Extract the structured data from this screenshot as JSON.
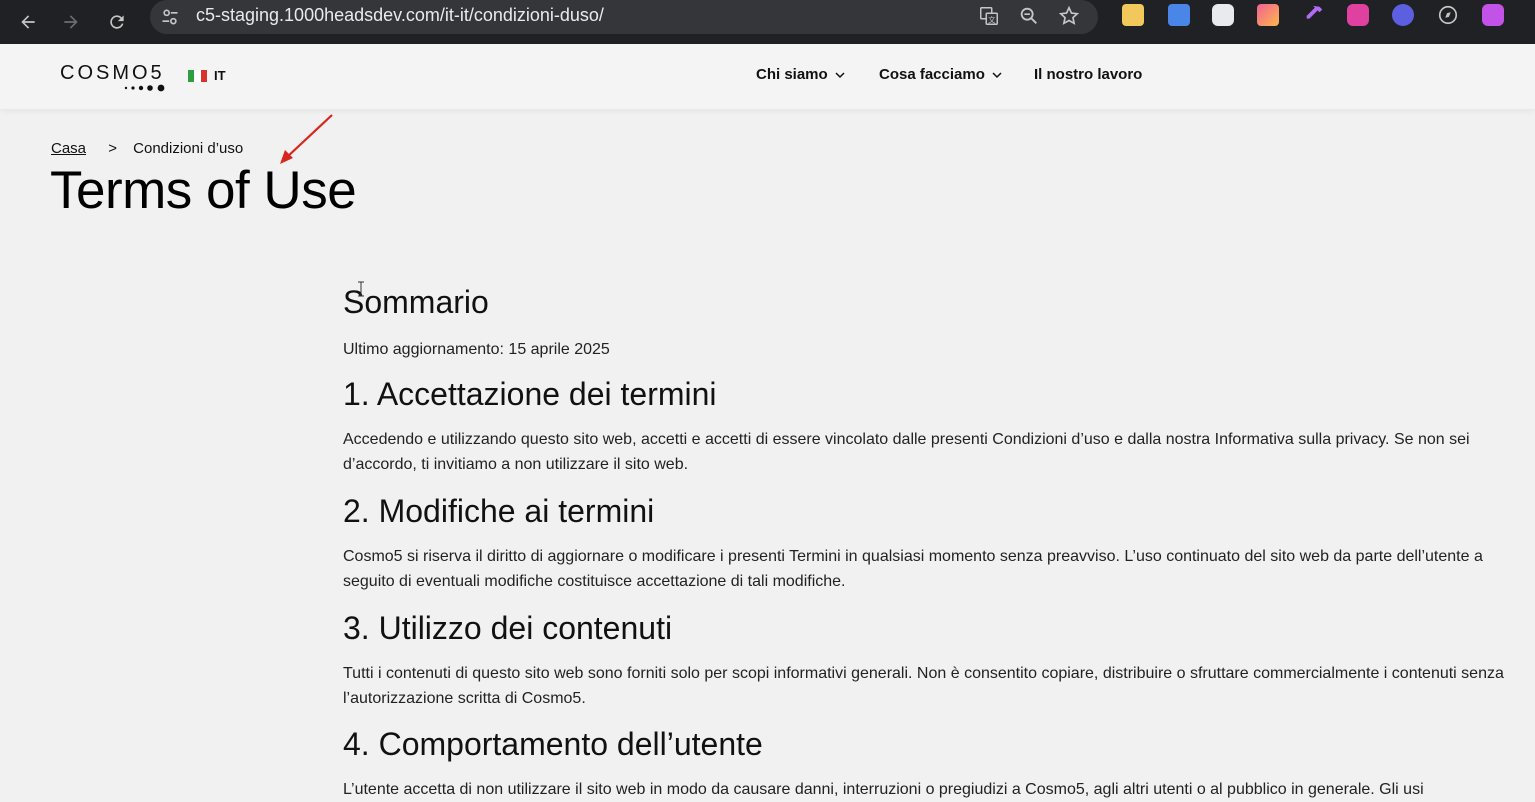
{
  "browser": {
    "url": "c5-staging.1000headsdev.com/it-it/condizioni-duso/"
  },
  "header": {
    "logo_text": "COSMO5",
    "language": "IT",
    "menu": [
      {
        "label": "Chi siamo"
      },
      {
        "label": "Cosa facciamo"
      },
      {
        "label": "Il nostro lavoro"
      }
    ],
    "flag_colors": [
      "#2e9e3e",
      "#ffffff",
      "#d8322e"
    ]
  },
  "breadcrumb": {
    "home": "Casa",
    "separator": ">",
    "current": "Condizioni d’uso"
  },
  "page": {
    "title": "Terms of Use",
    "summary_heading": "Sommario",
    "last_updated": "Ultimo aggiornamento: 15 aprile 2025",
    "sections": [
      {
        "heading": "1. Accettazione dei termini",
        "body": "Accedendo e utilizzando questo sito web, accetti e accetti di essere vincolato dalle presenti Condizioni d’uso e dalla nostra Informativa sulla privacy. Se non sei d’accordo, ti invitiamo a non utilizzare il sito web."
      },
      {
        "heading": "2. Modifiche ai termini",
        "body": "Cosmo5 si riserva il diritto di aggiornare o modificare i presenti Termini in qualsiasi momento senza preavviso. L’uso continuato del sito web da parte dell’utente a seguito di eventuali modifiche costituisce accettazione di tali modifiche."
      },
      {
        "heading": "3. Utilizzo dei contenuti",
        "body": "Tutti i contenuti di questo sito web sono forniti solo per scopi informativi generali. Non è consentito copiare, distribuire o sfruttare commercialmente i contenuti senza l’autorizzazione scritta di Cosmo5."
      },
      {
        "heading": "4. Comportamento dell’utente",
        "body": "L’utente accetta di non utilizzare il sito web in modo da causare danni, interruzioni o pregiudizi a Cosmo5, agli altri utenti o al pubblico in generale. Gli usi"
      }
    ]
  },
  "annotation_color": "#d9261c"
}
